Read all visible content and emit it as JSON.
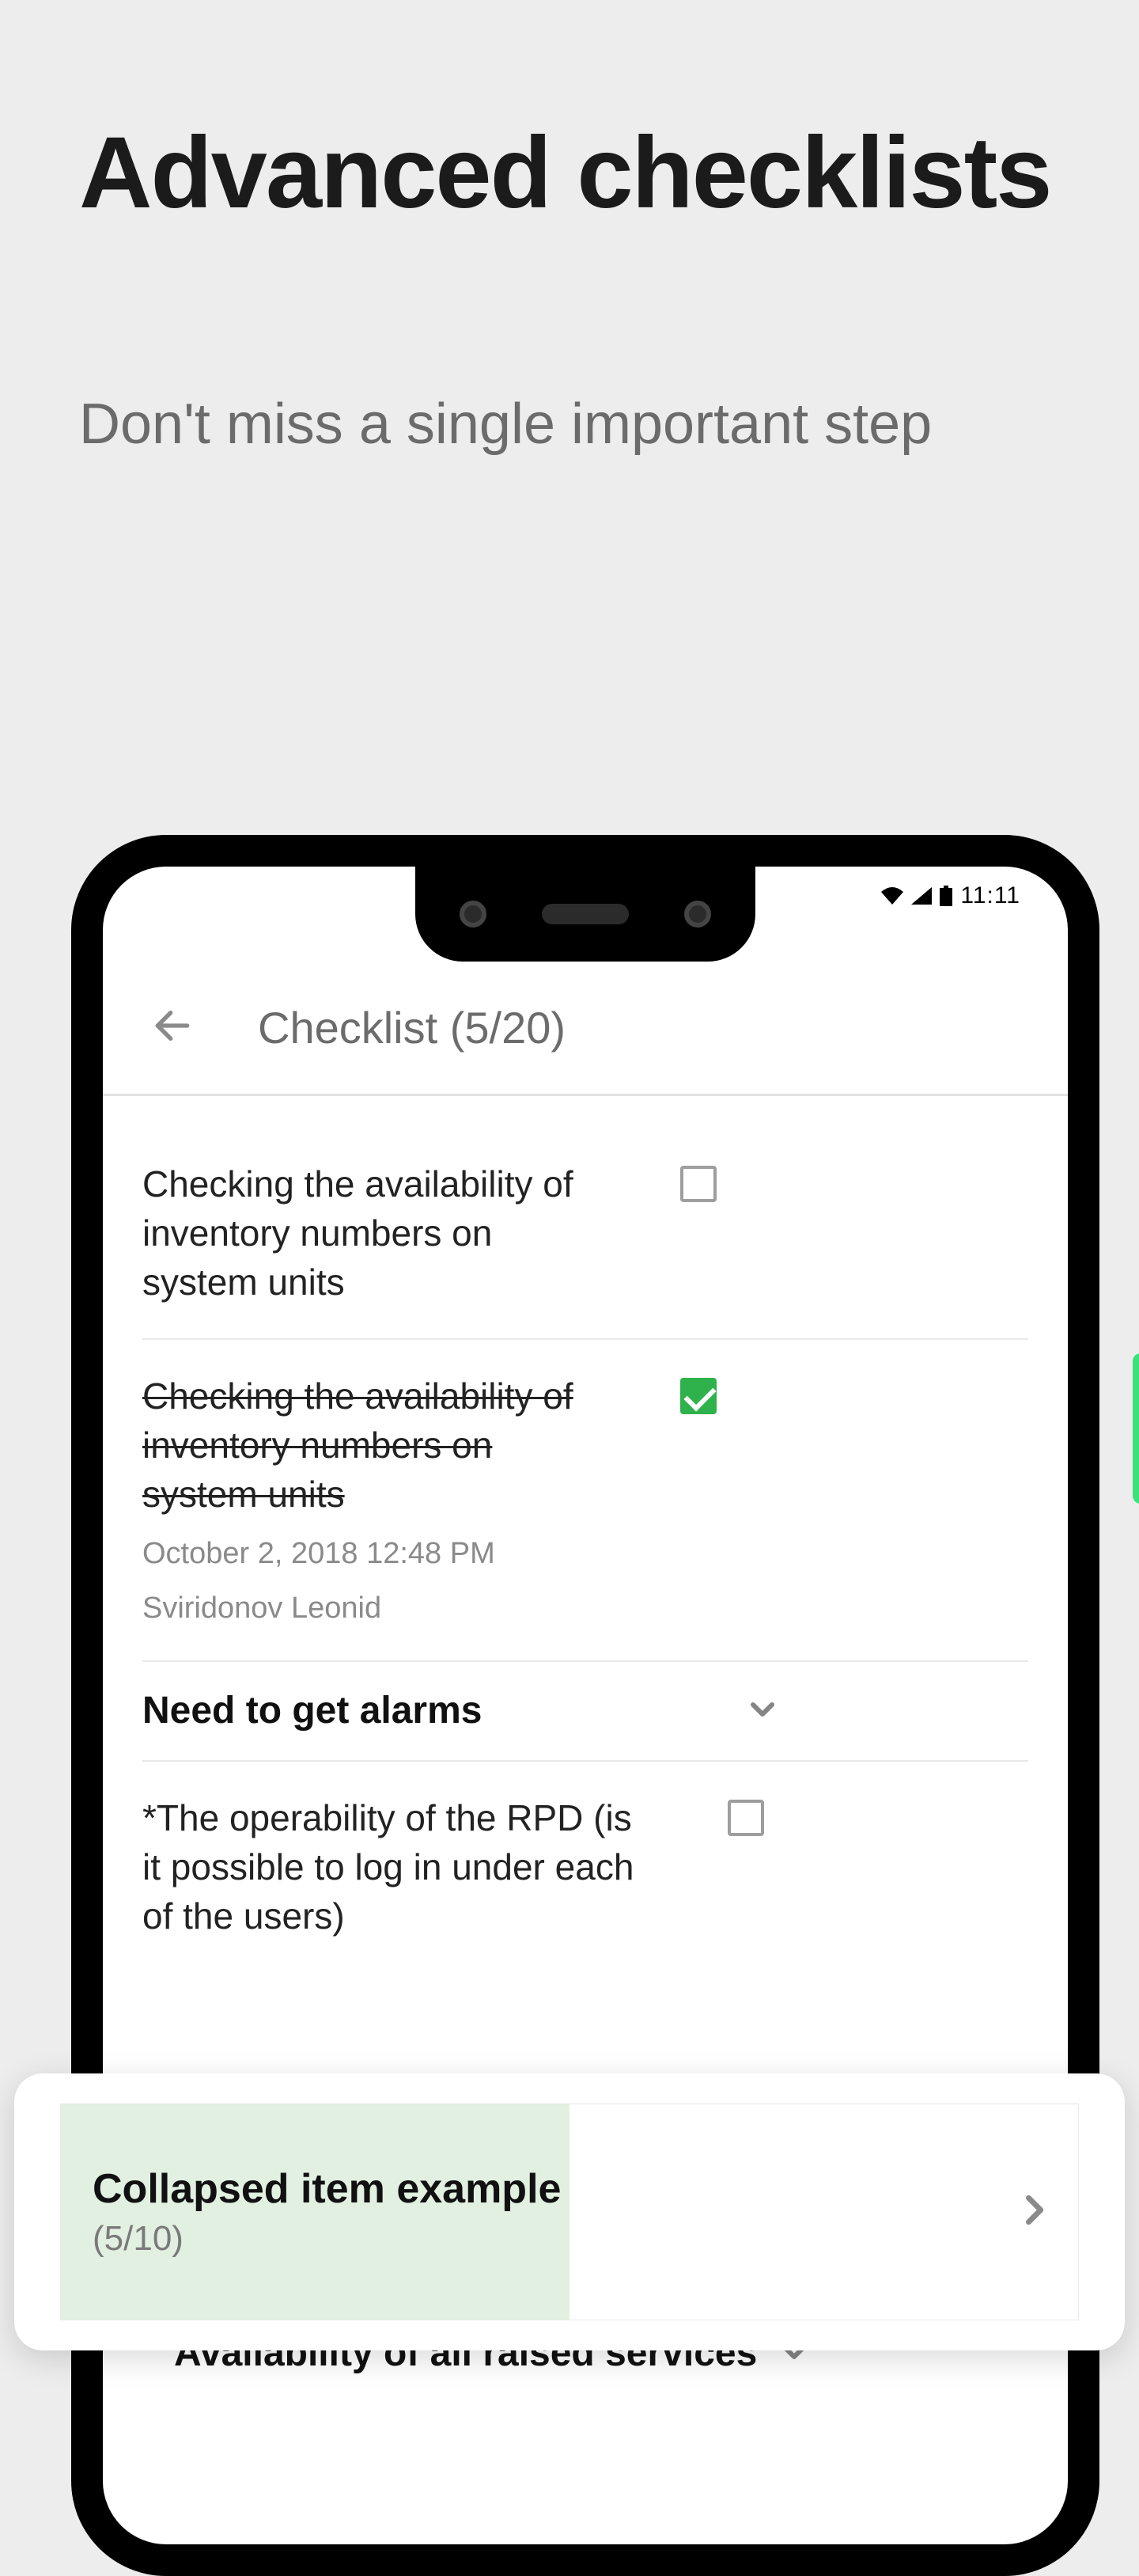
{
  "promo": {
    "title": "Advanced checklists",
    "subtitle": "Don't miss a single important step"
  },
  "statusbar": {
    "time": "11:11"
  },
  "appbar": {
    "title": "Checklist (5/20)"
  },
  "items": [
    {
      "label": "Checking the availability of inventory numbers on system units"
    },
    {
      "label": "Checking the availability of inventory numbers on system units",
      "timestamp": "October 2, 2018 12:48 PM",
      "author": "Sviridonov Leonid"
    },
    {
      "section": "Need to get alarms"
    },
    {
      "label": "*The operability of the RPD (is it possible to log in under each of the users)"
    },
    {
      "section": "Availability of all raised services"
    }
  ],
  "floating": {
    "title": "Collapsed item example",
    "count": "(5/10)",
    "progress_pct": 50
  },
  "colors": {
    "check_green": "#2fb24c",
    "side_green": "#3be27a",
    "progress_fill": "#e1f0e1"
  }
}
